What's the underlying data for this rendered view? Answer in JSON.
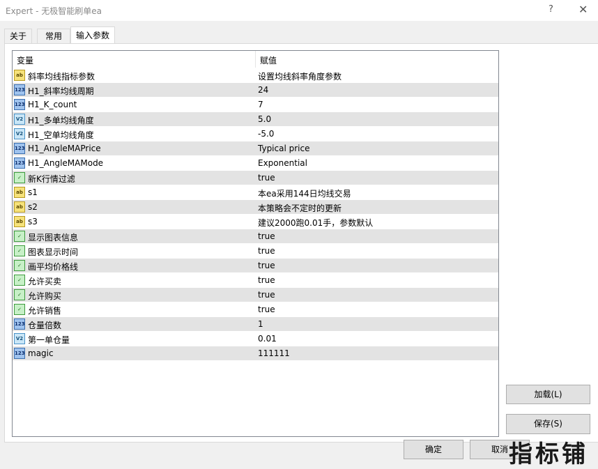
{
  "window": {
    "title": "Expert - 无极智能刷单ea",
    "help_label": "?",
    "close_label": "✕"
  },
  "tabs": [
    {
      "label": "关于",
      "active": false
    },
    {
      "label": "常用",
      "active": false
    },
    {
      "label": "输入参数",
      "active": true
    }
  ],
  "grid": {
    "headers": {
      "variable": "变量",
      "value": "赋值"
    },
    "rows": [
      {
        "icon": "ab",
        "icon_label": "ab",
        "name": "斜率均线指标参数",
        "value": "设置均线斜率角度参数"
      },
      {
        "icon": "num",
        "icon_label": "123",
        "name": "H1_斜率均线周期",
        "value": "24"
      },
      {
        "icon": "num",
        "icon_label": "123",
        "name": "H1_K_count",
        "value": "7"
      },
      {
        "icon": "real",
        "icon_label": "V2",
        "name": "H1_多单均线角度",
        "value": "5.0"
      },
      {
        "icon": "real",
        "icon_label": "V2",
        "name": "H1_空单均线角度",
        "value": "-5.0"
      },
      {
        "icon": "enum",
        "icon_label": "123",
        "name": "H1_AngleMAPrice",
        "value": "Typical price"
      },
      {
        "icon": "enum",
        "icon_label": "123",
        "name": "H1_AngleMAMode",
        "value": "Exponential"
      },
      {
        "icon": "bool",
        "icon_label": "✓",
        "name": "新K行情过滤",
        "value": "true"
      },
      {
        "icon": "ab",
        "icon_label": "ab",
        "name": "s1",
        "value": "本ea采用144日均线交易"
      },
      {
        "icon": "ab",
        "icon_label": "ab",
        "name": "s2",
        "value": "本策略会不定时的更新"
      },
      {
        "icon": "ab",
        "icon_label": "ab",
        "name": "s3",
        "value": "建议2000跑0.01手，参数默认"
      },
      {
        "icon": "bool",
        "icon_label": "✓",
        "name": "显示图表信息",
        "value": "true"
      },
      {
        "icon": "bool",
        "icon_label": "✓",
        "name": "图表显示时间",
        "value": "true"
      },
      {
        "icon": "bool",
        "icon_label": "✓",
        "name": "画平均价格线",
        "value": "true"
      },
      {
        "icon": "bool",
        "icon_label": "✓",
        "name": "允许买卖",
        "value": "true"
      },
      {
        "icon": "bool",
        "icon_label": "✓",
        "name": "允许购买",
        "value": "true"
      },
      {
        "icon": "bool",
        "icon_label": "✓",
        "name": "允许销售",
        "value": "true"
      },
      {
        "icon": "num",
        "icon_label": "123",
        "name": "仓量倍数",
        "value": "1"
      },
      {
        "icon": "real",
        "icon_label": "V2",
        "name": "第一单仓量",
        "value": "0.01"
      },
      {
        "icon": "num",
        "icon_label": "123",
        "name": "magic",
        "value": "111111"
      }
    ]
  },
  "buttons": {
    "load": "加载(L)",
    "save": "保存(S)",
    "ok": "确定",
    "cancel": "取消"
  },
  "watermark": "指标铺"
}
